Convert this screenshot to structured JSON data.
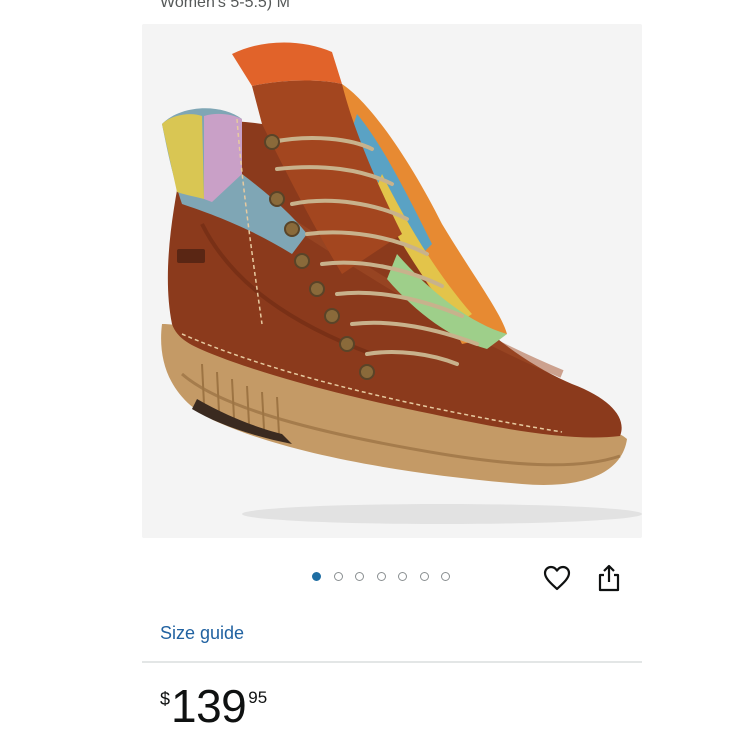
{
  "product": {
    "size_line": "Women's 5-5.5) M",
    "image_alt": "Brown leather lace-up hiker boot with multicolor knit collar"
  },
  "gallery": {
    "dot_count": 7,
    "active_index": 0,
    "accent_color": "#1f6ea3"
  },
  "actions": {
    "wishlist_icon": "heart-icon",
    "share_icon": "share-icon"
  },
  "links": {
    "size_guide": "Size guide"
  },
  "price": {
    "symbol": "$",
    "whole": "139",
    "fraction": "95"
  }
}
